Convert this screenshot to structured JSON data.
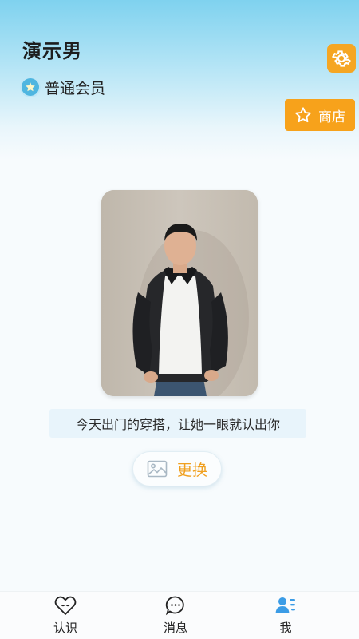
{
  "profile": {
    "name": "演示男",
    "membership": "普通会员"
  },
  "header": {
    "settings_icon": "gear-icon",
    "shop_label": "商店",
    "shop_icon": "star-icon"
  },
  "outfit": {
    "photo_desc_icon": "person-photo",
    "caption": "今天出门的穿搭，让她一眼就认出你",
    "change_label": "更换",
    "change_icon": "image-icon"
  },
  "tabs": [
    {
      "label": "认识",
      "icon": "heart-icon"
    },
    {
      "label": "消息",
      "icon": "chat-icon"
    },
    {
      "label": "我",
      "icon": "user-icon",
      "active": true
    }
  ],
  "colors": {
    "accent_orange": "#f7a21b",
    "accent_blue": "#4fb6e0",
    "header_gradient_top": "#7fd2ef"
  }
}
